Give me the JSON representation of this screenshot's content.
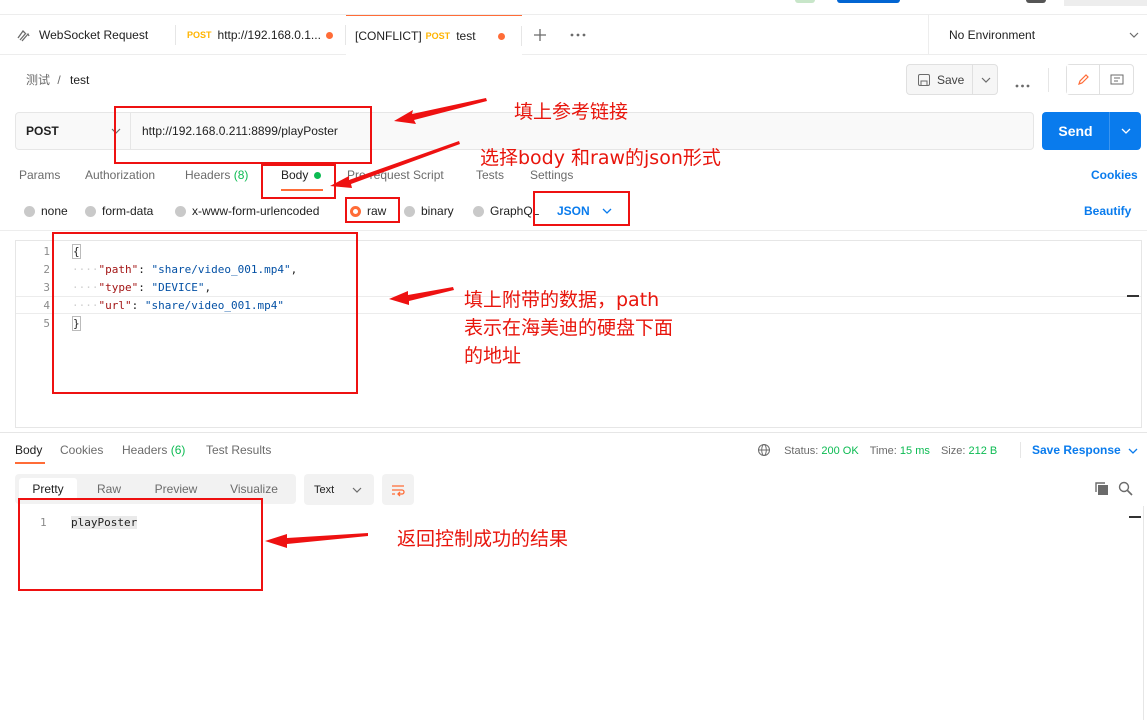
{
  "tabs": [
    {
      "label": "WebSocket Request"
    },
    {
      "method": "POST",
      "label": "http://192.168.0.1..."
    },
    {
      "prefix": "[CONFLICT]",
      "method": "POST",
      "label": "test"
    }
  ],
  "environment": "No Environment",
  "breadcrumb": {
    "parent": "测试",
    "separator": "/",
    "current": "test"
  },
  "save_label": "Save",
  "request": {
    "method": "POST",
    "url": "http://192.168.0.211:8899/playPoster",
    "send_label": "Send"
  },
  "request_tabs": [
    {
      "label": "Params"
    },
    {
      "label": "Authorization"
    },
    {
      "label": "Headers",
      "count": "(8)"
    },
    {
      "label": "Body"
    },
    {
      "label": "Pre-request Script"
    },
    {
      "label": "Tests"
    },
    {
      "label": "Settings"
    }
  ],
  "cookies_label": "Cookies",
  "body_options": [
    "none",
    "form-data",
    "x-www-form-urlencoded",
    "raw",
    "binary",
    "GraphQL"
  ],
  "selected_body_option": "raw",
  "format": "JSON",
  "beautify_label": "Beautify",
  "editor": {
    "line_numbers": [
      "1",
      "2",
      "3",
      "4",
      "5"
    ],
    "open_brace": "{",
    "close_brace": "}",
    "entries": [
      {
        "key": "\"path\"",
        "value": "\"share/video_001.mp4\"",
        "trail": ","
      },
      {
        "key": "\"type\"",
        "value": "\"DEVICE\"",
        "trail": ","
      },
      {
        "key": "\"url\"",
        "value": "\"share/video_001.mp4\"",
        "trail": ""
      }
    ]
  },
  "response_tabs": [
    {
      "label": "Body"
    },
    {
      "label": "Cookies"
    },
    {
      "label": "Headers",
      "count": "(6)"
    },
    {
      "label": "Test Results"
    }
  ],
  "response_status": {
    "status_label": "Status:",
    "status": "200 OK",
    "time_label": "Time:",
    "time": "15 ms",
    "size_label": "Size:",
    "size": "212 B"
  },
  "save_response_label": "Save Response",
  "view_modes": [
    "Pretty",
    "Raw",
    "Preview",
    "Visualize"
  ],
  "response_format": "Text",
  "response_body": {
    "line": "1",
    "text": "playPoster"
  },
  "annotations": {
    "url_note": "填上参考链接",
    "body_note": "选择body 和raw的json形式",
    "data_note": [
      "填上附带的数据，path",
      "表示在海美迪的硬盘下面",
      "的地址"
    ],
    "result_note": "返回控制成功的结果"
  },
  "colors": {
    "accent": "#ff6c37",
    "send": "#097bed",
    "annotation": "#e8150c",
    "success": "#0cbb52"
  }
}
